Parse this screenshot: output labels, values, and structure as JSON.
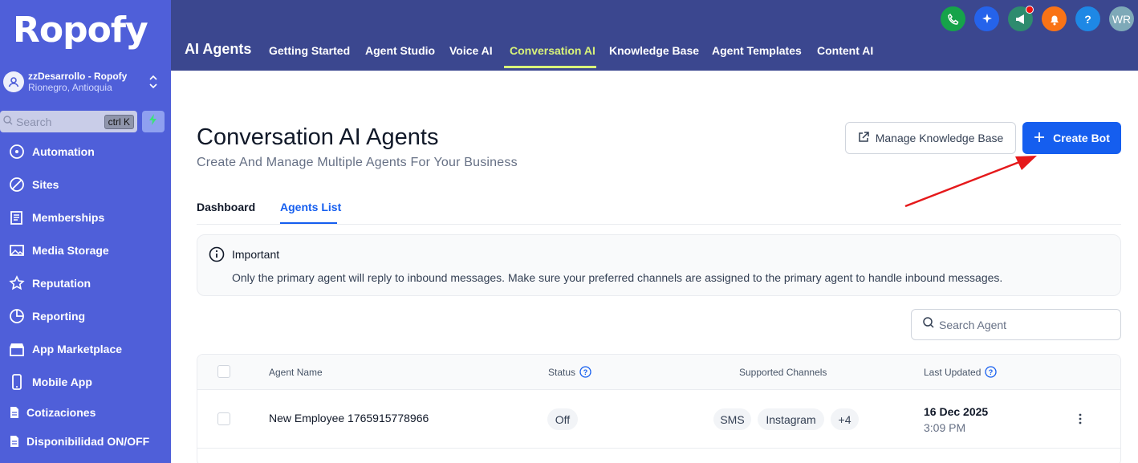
{
  "brand": {
    "logo_text": "Ropofy"
  },
  "account": {
    "name": "zzDesarrollo - Ropofy",
    "location": "Rionegro, Antioquia"
  },
  "sidebar_search": {
    "placeholder": "Search",
    "shortcut": "ctrl K"
  },
  "sidebar": {
    "items": [
      {
        "label": "Automation",
        "icon": "automation-icon"
      },
      {
        "label": "Sites",
        "icon": "sites-icon"
      },
      {
        "label": "Memberships",
        "icon": "memberships-icon"
      },
      {
        "label": "Media Storage",
        "icon": "media-storage-icon"
      },
      {
        "label": "Reputation",
        "icon": "reputation-icon"
      },
      {
        "label": "Reporting",
        "icon": "reporting-icon"
      },
      {
        "label": "App Marketplace",
        "icon": "marketplace-icon"
      },
      {
        "label": "Mobile App",
        "icon": "mobile-app-icon"
      },
      {
        "label": "Cotizaciones",
        "icon": "document-icon"
      },
      {
        "label": "Disponibilidad ON/OFF",
        "icon": "document-icon"
      }
    ]
  },
  "header": {
    "section_title": "AI Agents",
    "tabs": [
      {
        "label": "Getting Started"
      },
      {
        "label": "Agent Studio"
      },
      {
        "label": "Voice AI"
      },
      {
        "label": "Conversation AI",
        "active": true
      },
      {
        "label": "Knowledge Base"
      },
      {
        "label": "Agent Templates"
      },
      {
        "label": "Content AI"
      }
    ],
    "icons": [
      {
        "name": "phone-icon",
        "color": "#16a34a"
      },
      {
        "name": "sparkle-icon",
        "color": "#2563eb"
      },
      {
        "name": "megaphone-icon",
        "color": "#2e8b6e"
      },
      {
        "name": "bell-icon",
        "color": "#f97316"
      },
      {
        "name": "help-icon",
        "color": "#1e88e5",
        "text": "?"
      },
      {
        "name": "user-avatar",
        "color": "#7ea9b8",
        "text": "WR"
      }
    ]
  },
  "page": {
    "title": "Conversation AI Agents",
    "subtitle": "Create And Manage Multiple Agents For Your Business",
    "manage_kb_label": "Manage Knowledge Base",
    "create_bot_label": "Create Bot"
  },
  "tabs": [
    {
      "label": "Dashboard"
    },
    {
      "label": "Agents List",
      "active": true
    }
  ],
  "alert": {
    "title": "Important",
    "message": "Only the primary agent will reply to inbound messages. Make sure your preferred channels are assigned to the primary agent to handle inbound messages."
  },
  "search_agent": {
    "placeholder": "Search Agent"
  },
  "table": {
    "columns": [
      "Agent Name",
      "Status",
      "Supported Channels",
      "Last Updated"
    ],
    "rows": [
      {
        "name": "New Employee 1765915778966",
        "status": "Off",
        "channels": [
          "SMS",
          "Instagram"
        ],
        "more_channels": "+4",
        "updated_date": "16 Dec 2025",
        "updated_time": "3:09 PM"
      }
    ]
  },
  "colors": {
    "sidebar": "#4f5fd9",
    "topbar": "#3b478f",
    "accent": "#155eef",
    "active_top_tab": "#d8f27a",
    "annotation_arrow": "#e5191b"
  }
}
